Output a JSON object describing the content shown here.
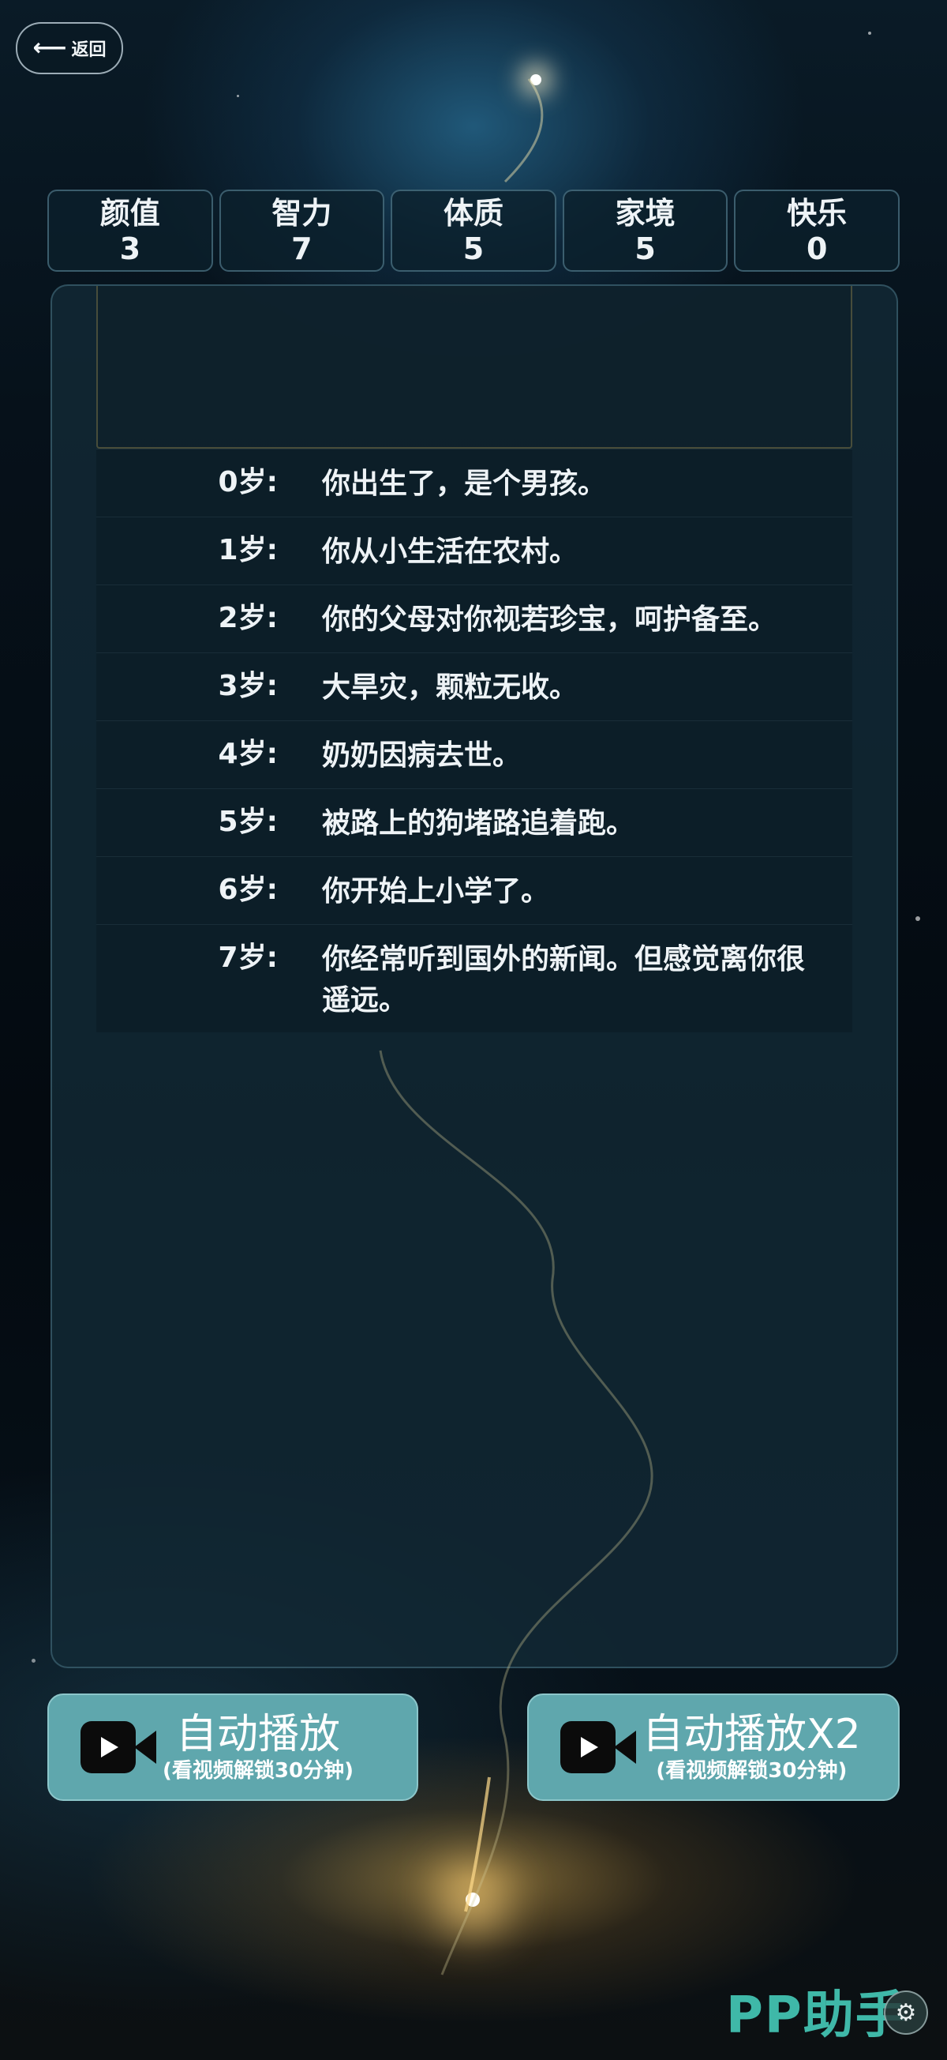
{
  "nav": {
    "back_label": "返回",
    "back_icon": "arrow-left-icon"
  },
  "stats": [
    {
      "label": "颜值",
      "value": "3"
    },
    {
      "label": "智力",
      "value": "7"
    },
    {
      "label": "体质",
      "value": "5"
    },
    {
      "label": "家境",
      "value": "5"
    },
    {
      "label": "快乐",
      "value": "0"
    }
  ],
  "log": [
    {
      "age": "0岁:",
      "text": "你出生了，是个男孩。"
    },
    {
      "age": "1岁:",
      "text": "你从小生活在农村。"
    },
    {
      "age": "2岁:",
      "text": "你的父母对你视若珍宝，呵护备至。"
    },
    {
      "age": "3岁:",
      "text": "大旱灾，颗粒无收。"
    },
    {
      "age": "4岁:",
      "text": "奶奶因病去世。"
    },
    {
      "age": "5岁:",
      "text": "被路上的狗堵路追着跑。"
    },
    {
      "age": "6岁:",
      "text": "你开始上小学了。"
    },
    {
      "age": "7岁:",
      "text": "你经常听到国外的新闻。但感觉离你很遥远。"
    }
  ],
  "buttons": {
    "auto_play": {
      "title": "自动播放",
      "subtitle": "(看视频解锁30分钟)",
      "icon": "video-camera-icon"
    },
    "auto_play_x2": {
      "title": "自动播放X2",
      "subtitle": "(看视频解锁30分钟)",
      "icon": "video-camera-icon"
    }
  },
  "watermark": {
    "text": "PP助手",
    "icon": "gear-icon"
  },
  "colors": {
    "button_bg": "#5fa7ad",
    "panel_bg": "#12303b",
    "watermark": "#3fb8a8"
  }
}
